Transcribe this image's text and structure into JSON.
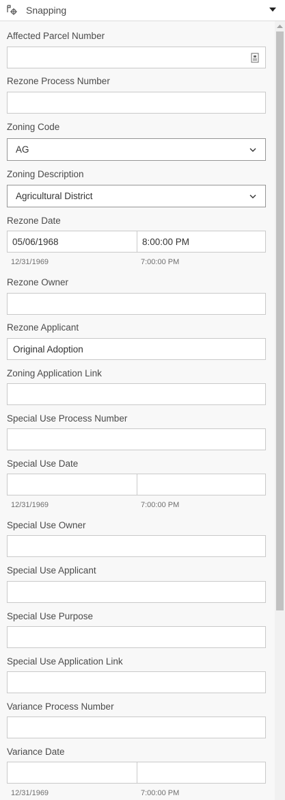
{
  "header": {
    "snapping_label": "Snapping"
  },
  "fields": {
    "affected_parcel_number": {
      "label": "Affected Parcel Number",
      "value": ""
    },
    "rezone_process_number": {
      "label": "Rezone Process Number",
      "value": ""
    },
    "zoning_code": {
      "label": "Zoning Code",
      "value": "AG"
    },
    "zoning_description": {
      "label": "Zoning Description",
      "value": "Agricultural District"
    },
    "rezone_date": {
      "label": "Rezone Date",
      "date": "05/06/1968",
      "time": "8:00:00 PM",
      "date_hint": "12/31/1969",
      "time_hint": "7:00:00 PM"
    },
    "rezone_owner": {
      "label": "Rezone Owner",
      "value": ""
    },
    "rezone_applicant": {
      "label": "Rezone Applicant",
      "value": "Original Adoption"
    },
    "zoning_application_link": {
      "label": "Zoning Application Link",
      "value": ""
    },
    "special_use_process_number": {
      "label": "Special Use Process Number",
      "value": ""
    },
    "special_use_date": {
      "label": "Special Use Date",
      "date": "",
      "time": "",
      "date_hint": "12/31/1969",
      "time_hint": "7:00:00 PM"
    },
    "special_use_owner": {
      "label": "Special Use Owner",
      "value": ""
    },
    "special_use_applicant": {
      "label": "Special Use Applicant",
      "value": ""
    },
    "special_use_purpose": {
      "label": "Special Use Purpose",
      "value": ""
    },
    "special_use_application_link": {
      "label": "Special Use Application Link",
      "value": ""
    },
    "variance_process_number": {
      "label": "Variance Process Number",
      "value": ""
    },
    "variance_date": {
      "label": "Variance Date",
      "date": "",
      "time": "",
      "date_hint": "12/31/1969",
      "time_hint": "7:00:00 PM"
    }
  }
}
